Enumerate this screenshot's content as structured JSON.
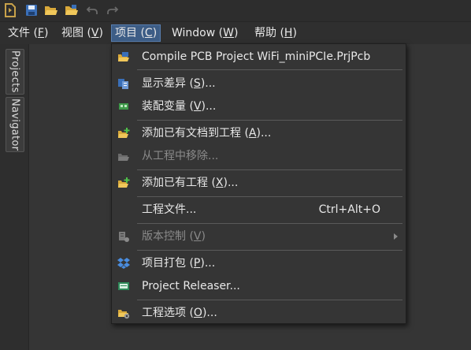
{
  "menubar": {
    "items": [
      {
        "label": "文件 (",
        "mnemonic": "F",
        "suffix": ")"
      },
      {
        "label": "视图 (",
        "mnemonic": "V",
        "suffix": ")"
      },
      {
        "label": "项目 (",
        "mnemonic": "C",
        "suffix": ")"
      },
      {
        "label": "Window (",
        "mnemonic": "W",
        "suffix": ")"
      },
      {
        "label": "帮助 (",
        "mnemonic": "H",
        "suffix": ")"
      }
    ]
  },
  "dock": {
    "tabs": [
      "Projects",
      "Navigator"
    ]
  },
  "dropdown": {
    "items": [
      {
        "pre": "Compile PCB Project WiFi_miniPCIe.PrjPcb",
        "mn": "",
        "post": "",
        "icon": "compile-icon"
      },
      {
        "pre": "显示差异 (",
        "mn": "S",
        "post": ")...",
        "icon": "compare-icon"
      },
      {
        "pre": "装配变量 (",
        "mn": "V",
        "post": ")...",
        "icon": "variants-icon"
      },
      {
        "pre": "添加已有文档到工程 (",
        "mn": "A",
        "post": ")...",
        "icon": "add-document-icon"
      },
      {
        "pre": "从工程中移除...",
        "mn": "",
        "post": "",
        "icon": "remove-document-icon"
      },
      {
        "pre": "添加已有工程 (",
        "mn": "X",
        "post": ")...",
        "icon": "add-project-icon"
      },
      {
        "pre": "工程文件...",
        "mn": "",
        "post": "",
        "shortcut": "Ctrl+Alt+O"
      },
      {
        "pre": "版本控制 (",
        "mn": "V",
        "post": ")",
        "icon": "version-control-icon"
      },
      {
        "pre": "项目打包 (",
        "mn": "P",
        "post": ")...",
        "icon": "dropbox-icon"
      },
      {
        "pre": "Project Releaser...",
        "mn": "",
        "post": "",
        "icon": "releaser-icon"
      },
      {
        "pre": "工程选项 (",
        "mn": "O",
        "post": ")...",
        "icon": "project-options-icon"
      }
    ]
  },
  "colors": {
    "background": "#353535",
    "menu_active": "#3d5d86",
    "text": "#e8e8e8",
    "disabled_text": "#8a8a8a"
  }
}
